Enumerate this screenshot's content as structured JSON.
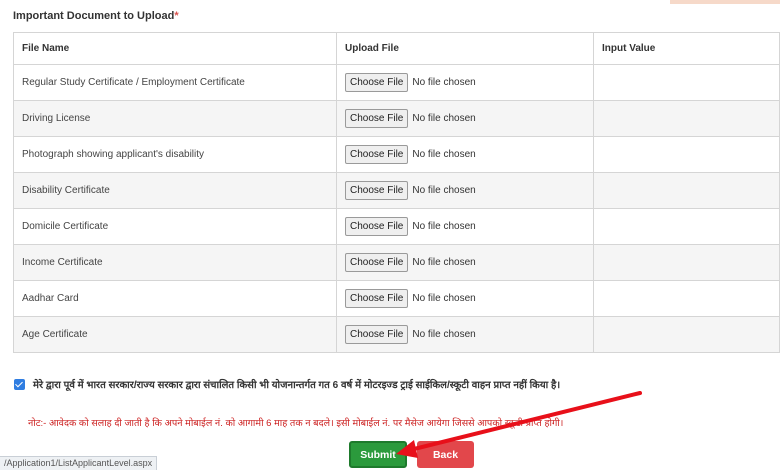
{
  "section": {
    "title": "Important Document to Upload",
    "required_mark": "*"
  },
  "table": {
    "headers": [
      "File Name",
      "Upload File",
      "Input Value"
    ],
    "rows": [
      {
        "name": "Regular Study Certificate / Employment Certificate",
        "button": "Choose File",
        "status": "No file chosen",
        "value": ""
      },
      {
        "name": "Driving License",
        "button": "Choose File",
        "status": "No file chosen",
        "value": ""
      },
      {
        "name": "Photograph showing applicant's disability",
        "button": "Choose File",
        "status": "No file chosen",
        "value": ""
      },
      {
        "name": "Disability Certificate",
        "button": "Choose File",
        "status": "No file chosen",
        "value": ""
      },
      {
        "name": "Domicile Certificate",
        "button": "Choose File",
        "status": "No file chosen",
        "value": ""
      },
      {
        "name": "Income Certificate",
        "button": "Choose File",
        "status": "No file chosen",
        "value": ""
      },
      {
        "name": "Aadhar Card",
        "button": "Choose File",
        "status": "No file chosen",
        "value": ""
      },
      {
        "name": "Age Certificate",
        "button": "Choose File",
        "status": "No file chosen",
        "value": ""
      }
    ]
  },
  "declaration": {
    "checked": true,
    "text": "मेरे द्वारा पूर्व में भारत सरकार/राज्य सरकार द्वारा संचालित किसी भी योजनान्तर्गत गत 6 वर्ष में मोटरइज्ड ट्राई साईकिल/स्कूटी वाहन प्राप्त नहीं किया है।"
  },
  "note": {
    "text": "नोट:- आवेदक को सलाह दी जाती है कि अपने मोबाईल नं. को आगामी 6 माह तक न बदले। इसी मोबाईल नं. पर मैसेज आयेगा जिससे आपको स्कूटी प्राप्त होगी।"
  },
  "actions": {
    "submit_label": "Submit",
    "back_label": "Back"
  },
  "status_bar": {
    "url": "/Application1/ListApplicantLevel.aspx"
  },
  "annotation": {
    "arrow_color": "#e8101a"
  }
}
